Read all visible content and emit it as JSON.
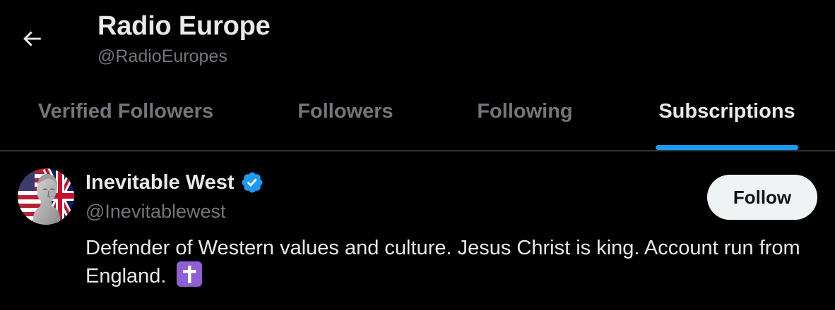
{
  "header": {
    "title": "Radio Europe",
    "handle": "@RadioEuropes",
    "back_icon": "arrow-left-icon"
  },
  "tabs": [
    {
      "label": "Verified Followers",
      "active": false
    },
    {
      "label": "Followers",
      "active": false
    },
    {
      "label": "Following",
      "active": false
    },
    {
      "label": "Subscriptions",
      "active": true
    }
  ],
  "users": [
    {
      "name": "Inevitable West",
      "handle": "@Inevitablewest",
      "verified": true,
      "bio": "Defender of Western values and culture. Jesus Christ is king. Account run from England.",
      "bio_emoji": "latin-cross-emoji",
      "follow_label": "Follow"
    }
  ],
  "colors": {
    "background": "#000000",
    "primary_text": "#e7e9ea",
    "secondary_text": "#71767b",
    "accent": "#1d9bf0",
    "divider": "#2f3336",
    "follow_button_bg": "#eff3f4",
    "follow_button_text": "#0f1419",
    "emoji_purple": "#8e5fd6"
  }
}
